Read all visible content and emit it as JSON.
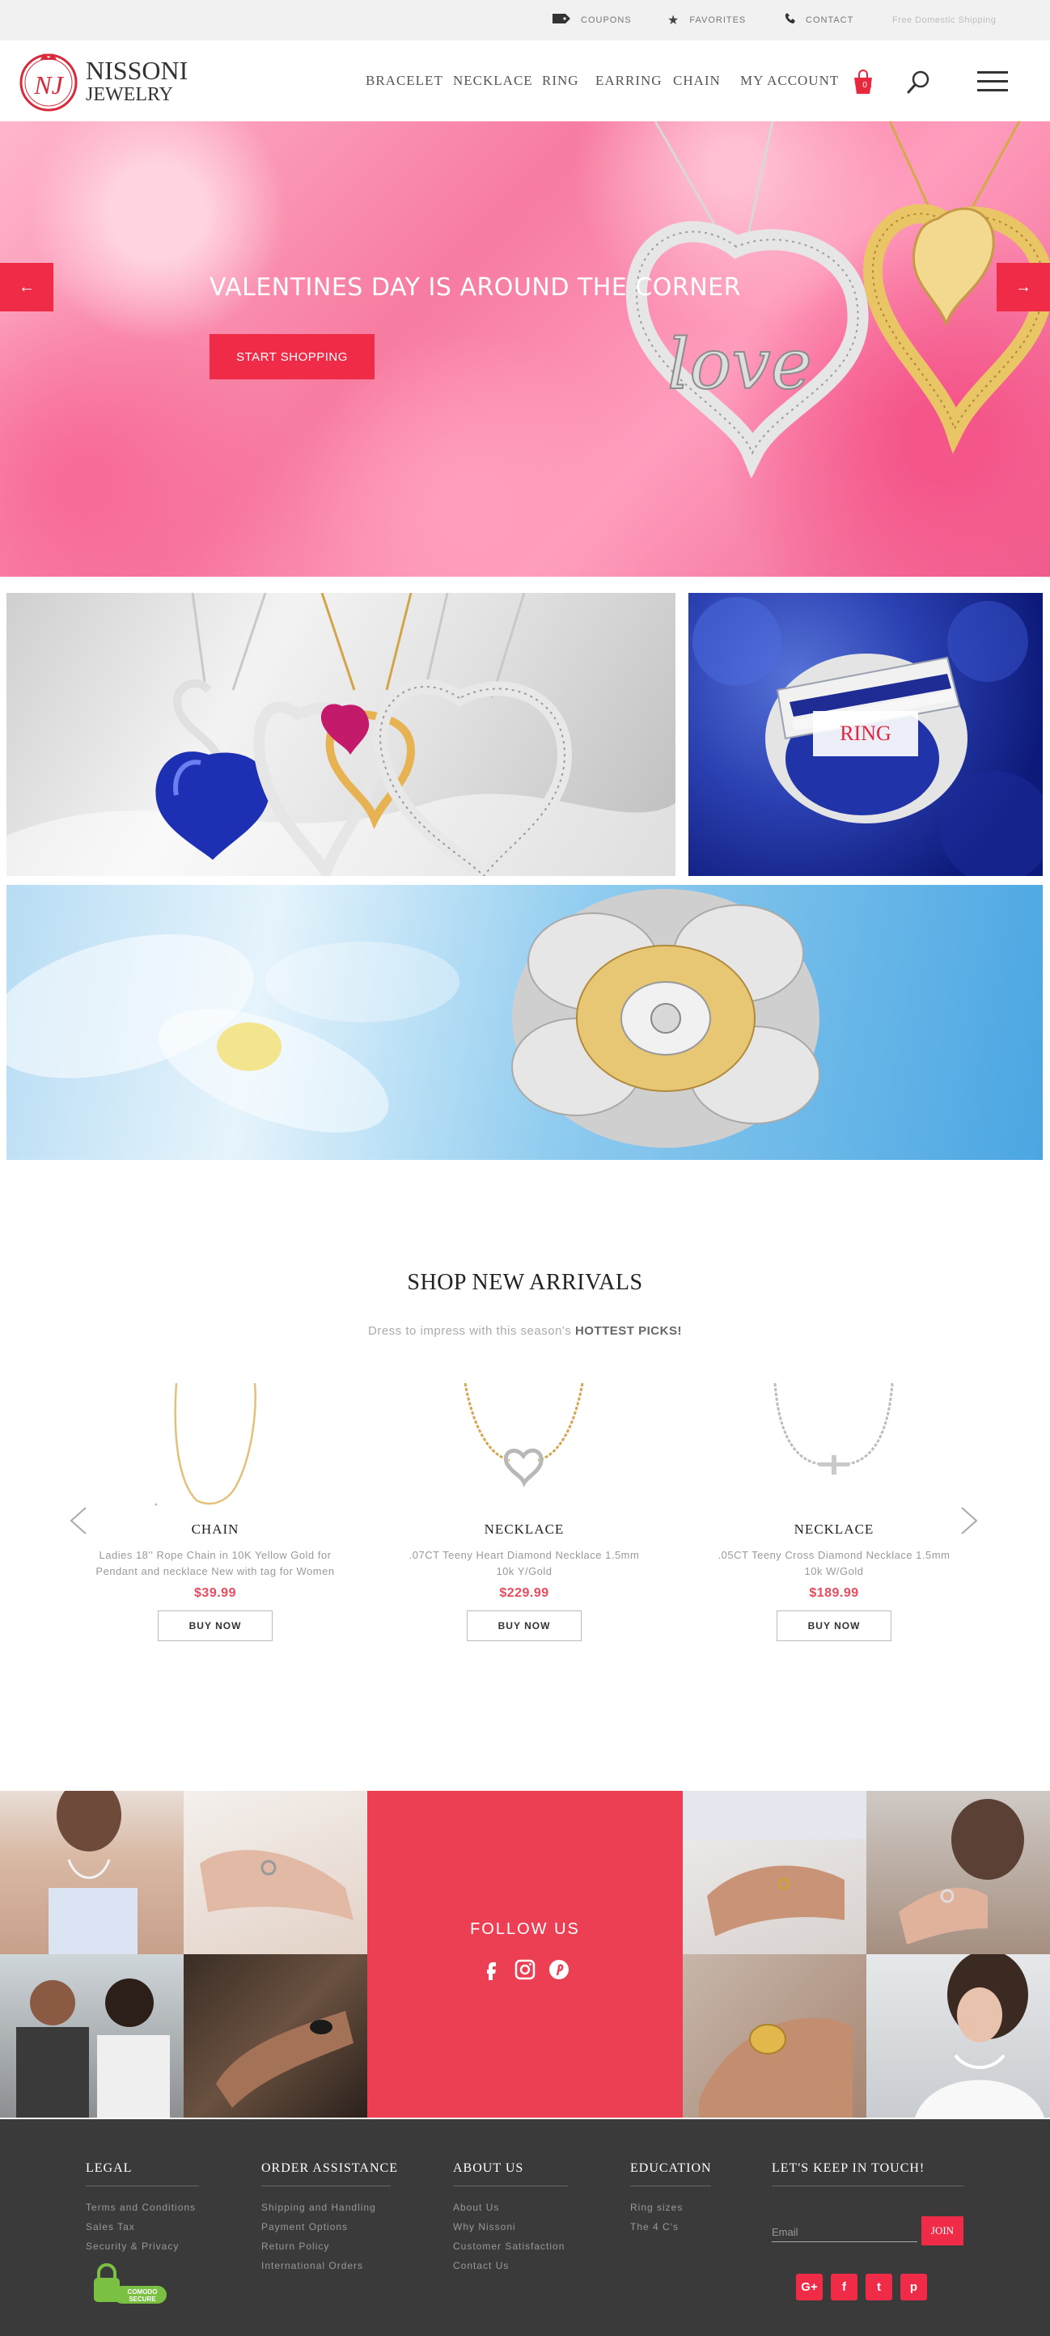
{
  "topbar": {
    "coupons": "COUPONS",
    "favorites": "FAVORITES",
    "contact": "CONTACT",
    "shipping": "Free Domestic Shipping"
  },
  "header": {
    "brand_line1": "NISSONI",
    "brand_line2": "JEWELRY",
    "logo_initials": "NJ",
    "nav": [
      "BRACELET",
      "NECKLACE",
      "RING",
      "EARRING",
      "CHAIN",
      "MY ACCOUNT"
    ],
    "cart_count": "0"
  },
  "hero": {
    "title": "VALENTINES DAY IS AROUND THE CORNER",
    "cta": "START SHOPPING",
    "prev": "←",
    "next": "→"
  },
  "promos": {
    "ring_label": "RING"
  },
  "arrivals": {
    "title": "SHOP NEW ARRIVALS",
    "subtitle_prefix": "Dress to impress with this season's ",
    "subtitle_bold": "HOTTEST PICKS!",
    "products": [
      {
        "category": "CHAIN",
        "name": "Ladies 18'' Rope Chain in 10K Yellow Gold for Pendant and necklace New with tag for Women",
        "price": "$39.99",
        "button": "BUY NOW"
      },
      {
        "category": "NECKLACE",
        "name": ".07CT Teeny Heart Diamond Necklace 1.5mm 10k Y/Gold",
        "price": "$229.99",
        "button": "BUY NOW"
      },
      {
        "category": "NECKLACE",
        "name": ".05CT Teeny Cross Diamond Necklace 1.5mm 10k W/Gold",
        "price": "$189.99",
        "button": "BUY NOW"
      }
    ]
  },
  "gallery": {
    "follow": "FOLLOW US"
  },
  "footer": {
    "columns": [
      {
        "heading": "LEGAL",
        "links": [
          "Terms and Conditions",
          "Sales Tax",
          "Security & Privacy"
        ]
      },
      {
        "heading": "ORDER ASSISTANCE",
        "links": [
          "Shipping and Handling",
          "Payment Options",
          "Return Policy",
          "International Orders"
        ]
      },
      {
        "heading": "ABOUT US",
        "links": [
          "About Us",
          "Why Nissoni",
          "Customer Satisfaction",
          "Contact Us"
        ]
      },
      {
        "heading": "EDUCATION",
        "links": [
          "Ring sizes",
          "The 4 C's"
        ]
      },
      {
        "heading": "LET'S KEEP IN TOUCH!",
        "links": []
      }
    ],
    "email_placeholder": "Email",
    "join": "JOIN",
    "comodo_line1": "COMODO",
    "comodo_line2": "SECURE",
    "social": [
      "G+",
      "f",
      "t",
      "p"
    ]
  },
  "colors": {
    "accent": "#ef2b47",
    "footer_bg": "#3a3a3a",
    "price": "#e84b5e"
  }
}
